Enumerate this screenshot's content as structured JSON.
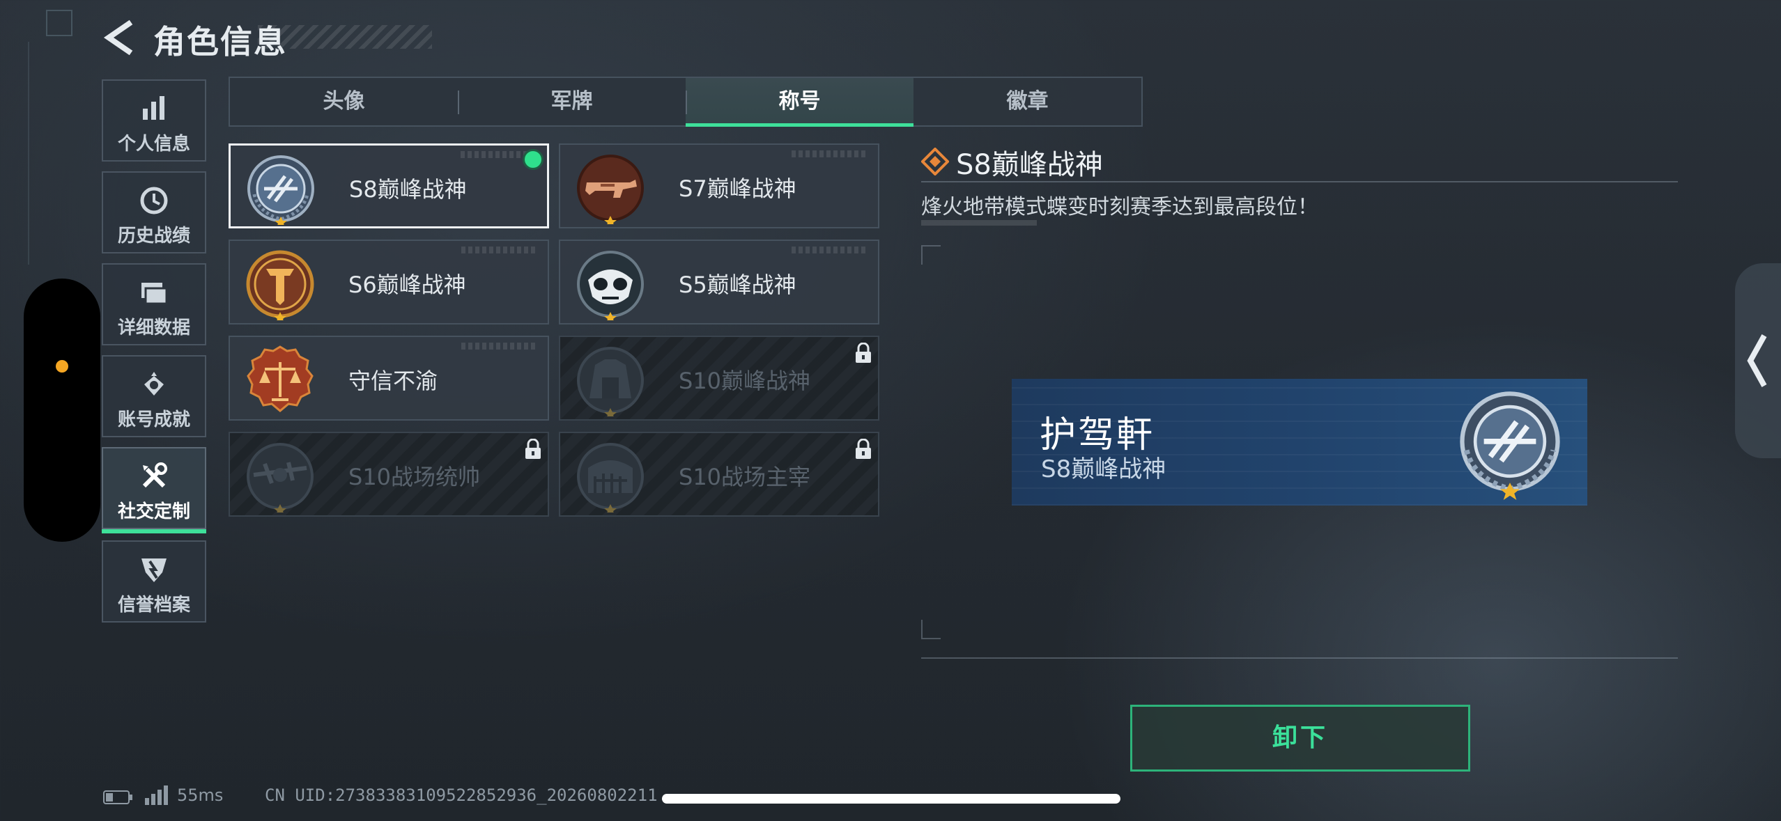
{
  "header": {
    "title": "角色信息"
  },
  "sidebar": {
    "items": [
      {
        "label": "个人信息",
        "icon": "bar-chart-icon"
      },
      {
        "label": "历史战绩",
        "icon": "clock-icon"
      },
      {
        "label": "详细数据",
        "icon": "folder-icon"
      },
      {
        "label": "账号成就",
        "icon": "medal-icon"
      },
      {
        "label": "社交定制",
        "icon": "tools-icon",
        "active": true
      },
      {
        "label": "信誉档案",
        "icon": "shield-icon"
      }
    ]
  },
  "tabs": [
    {
      "label": "头像"
    },
    {
      "label": "军牌"
    },
    {
      "label": "称号",
      "active": true
    },
    {
      "label": "徽章"
    }
  ],
  "titles": [
    {
      "label": "S8巅峰战神",
      "badge": "s8-badge-icon",
      "selected": true,
      "equipped": true,
      "locked": false
    },
    {
      "label": "S7巅峰战神",
      "badge": "s7-badge-icon",
      "locked": false
    },
    {
      "label": "S6巅峰战神",
      "badge": "s6-badge-icon",
      "locked": false
    },
    {
      "label": "S5巅峰战神",
      "badge": "s5-badge-icon",
      "locked": false
    },
    {
      "label": "守信不渝",
      "badge": "scales-badge-icon",
      "locked": false
    },
    {
      "label": "S10巅峰战神",
      "badge": "s10-badge-icon",
      "locked": true
    },
    {
      "label": "S10战场统帅",
      "badge": "s10-commander-badge-icon",
      "locked": true
    },
    {
      "label": "S10战场主宰",
      "badge": "s10-ruler-badge-icon",
      "locked": true
    }
  ],
  "detail": {
    "title": "S8巅峰战神",
    "description": "烽火地带模式蝶变时刻赛季达到最高段位！"
  },
  "preview": {
    "player_name": "护驾軒",
    "title": "S8巅峰战神"
  },
  "actions": {
    "unequip_label": "卸下"
  },
  "status": {
    "ping": "55ms",
    "uid": "CN UID:27383383109522852936_20260802211"
  },
  "colors": {
    "accent": "#3ee09a",
    "equipped_dot": "#2fe08c",
    "side_dot": "#f5a623",
    "nameplate": "#21436c"
  }
}
